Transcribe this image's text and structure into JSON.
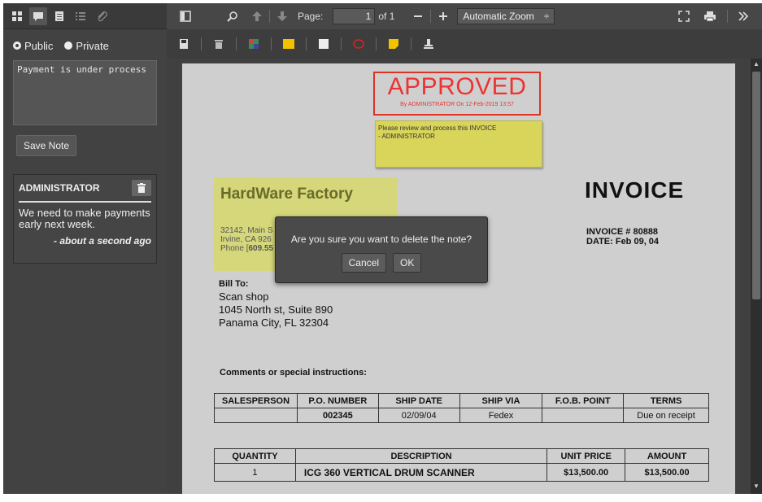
{
  "sidebar": {
    "visibility": {
      "public_label": "Public",
      "private_label": "Private",
      "selected": "Public"
    },
    "note_value": "Payment is under process",
    "save_label": "Save Note",
    "note": {
      "author": "ADMINISTRATOR",
      "body": "We need to make payments early next week.",
      "time": "- about a second ago"
    }
  },
  "toolbar": {
    "page_label": "Page:",
    "page_value": "1",
    "page_total": "of 1",
    "zoom_value": "Automatic Zoom",
    "zoom_arrow": "÷"
  },
  "document": {
    "stamp_word": "APPROVED",
    "stamp_sub": "By ADMINISTRATOR On 12-Feb-2019 13:57",
    "sticky_line1": "Please review and process this INVOICE",
    "sticky_line2": " - ADMINISTRATOR",
    "company": "HardWare Factory",
    "addr1": "32142, Main S",
    "addr2": "Irvine, CA 926",
    "addr3_label": "Phone [",
    "addr3_value": "609.55",
    "invoice_title": "INVOICE",
    "invoice_number": "INVOICE # 80888",
    "invoice_date": "DATE: Feb 09, 04",
    "bill_to_label": "Bill To:",
    "bill_to_lines": [
      "Scan shop",
      "1045 North st, Suite 890",
      "Panama City, FL 32304"
    ],
    "comments_label": "Comments or special instructions:",
    "order_headers": [
      "SALESPERSON",
      "P.O. NUMBER",
      "SHIP DATE",
      "SHIP VIA",
      "F.O.B. POINT",
      "TERMS"
    ],
    "order_row": [
      "",
      "002345",
      "02/09/04",
      "Fedex",
      "",
      "Due on receipt"
    ],
    "item_headers": [
      "QUANTITY",
      "DESCRIPTION",
      "UNIT PRICE",
      "AMOUNT"
    ],
    "item_row": [
      "1",
      "ICG 360 VERTICAL DRUM SCANNER",
      "$13,500.00",
      "$13,500.00"
    ]
  },
  "dialog": {
    "message": "Are you sure you want to delete the note?",
    "cancel_label": "Cancel",
    "ok_label": "OK"
  },
  "colors": {
    "stamp": "#dd3322",
    "sticky": "#d9d45a",
    "highlight": "#d5d77a"
  }
}
